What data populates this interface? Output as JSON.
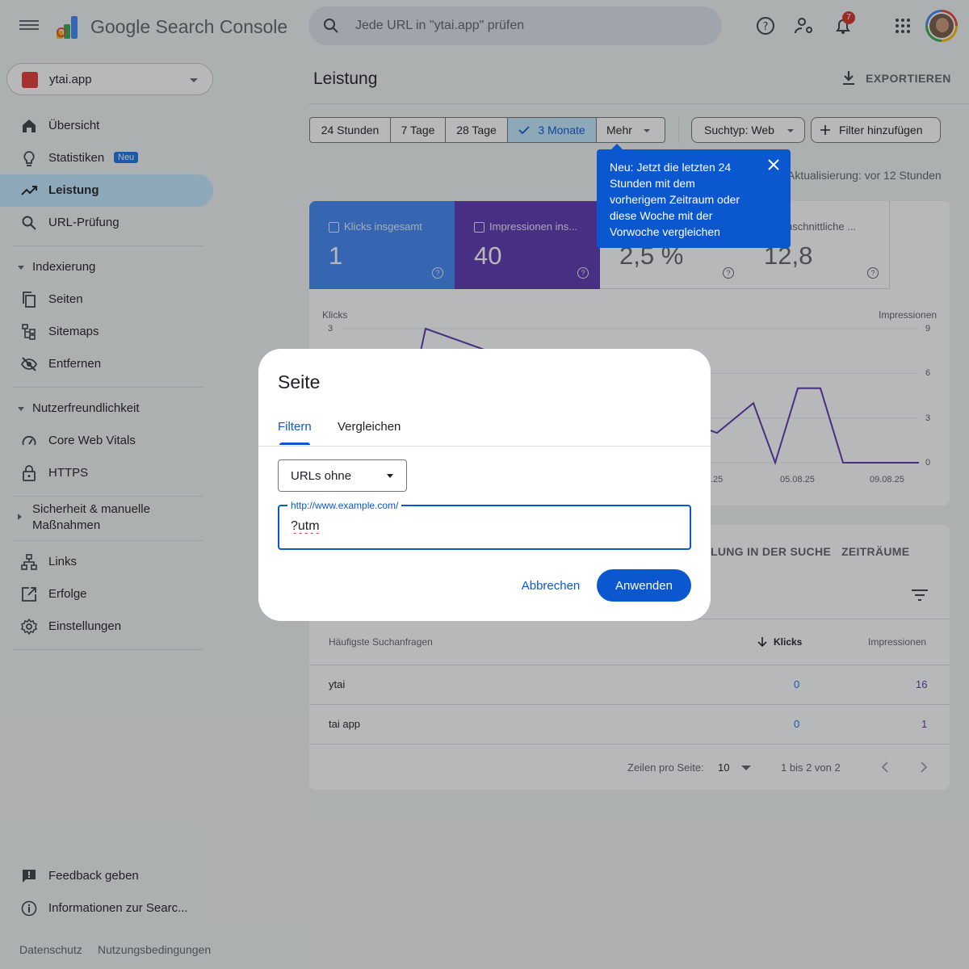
{
  "header": {
    "app_title": "Google Search Console",
    "search_placeholder": "Jede URL in \"ytai.app\" prüfen",
    "notification_count": "7"
  },
  "sidebar": {
    "property": "ytai.app",
    "items": [
      {
        "label": "Übersicht"
      },
      {
        "label": "Statistiken",
        "badge": "Neu"
      },
      {
        "label": "Leistung"
      },
      {
        "label": "URL-Prüfung"
      }
    ],
    "indexing": {
      "title": "Indexierung",
      "items": [
        {
          "label": "Seiten"
        },
        {
          "label": "Sitemaps"
        },
        {
          "label": "Entfernen"
        }
      ]
    },
    "experience": {
      "title": "Nutzerfreundlichkeit",
      "items": [
        {
          "label": "Core Web Vitals"
        },
        {
          "label": "HTTPS"
        }
      ]
    },
    "security": {
      "title_line1": "Sicherheit & manuelle",
      "title_line2": "Maßnahmen"
    },
    "other": [
      {
        "label": "Links"
      },
      {
        "label": "Erfolge"
      },
      {
        "label": "Einstellungen"
      }
    ],
    "footer_items": [
      {
        "label": "Feedback geben"
      },
      {
        "label": "Informationen zur Searc..."
      }
    ],
    "footer_links": {
      "privacy": "Datenschutz",
      "terms": "Nutzungsbedingungen"
    }
  },
  "main": {
    "title": "Leistung",
    "export_label": "EXPORTIEREN",
    "date_ranges": [
      "24 Stunden",
      "7 Tage",
      "28 Tage",
      "3 Monate",
      "Mehr"
    ],
    "selected_range": "3 Monate",
    "search_type": "Suchtyp: Web",
    "add_filter": "Filter hinzufügen",
    "last_update": "Aktualisierung: vor 12 Stunden",
    "tooltip": "Neu: Jetzt die letzten 24 Stunden mit dem vorherigem Zeitraum oder diese Woche mit der Vorwoche vergleichen",
    "metrics": [
      {
        "label": "Klicks insgesamt",
        "value": "1",
        "color": "#4285f4"
      },
      {
        "label": "Impressionen ins...",
        "value": "40",
        "color": "#5e35b1"
      },
      {
        "label": "",
        "value": "2,5 %",
        "color": "#ffffff"
      },
      {
        "label": "urchschnittliche ...",
        "value": "12,8",
        "color": "#ffffff"
      }
    ],
    "chart_data": {
      "type": "line",
      "ylabel_left": "Klicks",
      "ylabel_right": "Impressionen",
      "y_left_ticks": [
        "3"
      ],
      "y_right_ticks": [
        "9",
        "6",
        "3",
        "0"
      ],
      "x_ticks": [
        ".25",
        "05.08.25",
        "09.08.25"
      ],
      "series": [
        {
          "name": "Impressionen",
          "color": "#5e35b1",
          "values": [
            0,
            9,
            2,
            4,
            0,
            5,
            5,
            0,
            0,
            0
          ]
        }
      ]
    },
    "tabs": [
      "LUNG IN DER SUCHE",
      "ZEITRÄUME"
    ],
    "table": {
      "headers": {
        "query": "Häufigste Suchanfragen",
        "clicks": "Klicks",
        "impressions": "Impressionen"
      },
      "rows": [
        {
          "query": "ytai",
          "clicks": "0",
          "impressions": "16"
        },
        {
          "query": "tai app",
          "clicks": "0",
          "impressions": "1"
        }
      ],
      "rows_per_page_label": "Zeilen pro Seite:",
      "rows_per_page": "10",
      "range": "1 bis 2 von 2"
    }
  },
  "dialog": {
    "title": "Seite",
    "tabs": {
      "filter": "Filtern",
      "compare": "Vergleichen"
    },
    "operator": "URLs ohne",
    "field_label": "http://www.example.com/",
    "field_value": "?utm",
    "cancel": "Abbrechen",
    "apply": "Anwenden"
  },
  "colors": {
    "primary": "#0b57d0",
    "clicks": "#4285f4",
    "impressions": "#5e35b1",
    "active_nav": "#c2e7ff"
  }
}
